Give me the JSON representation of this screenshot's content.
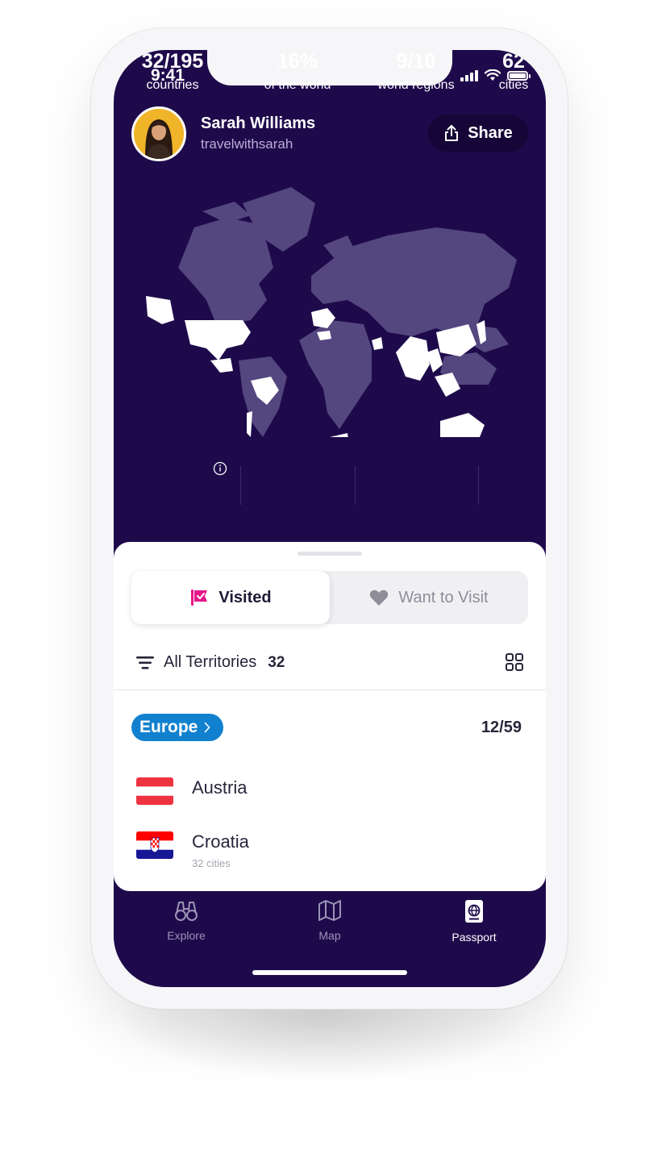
{
  "status": {
    "time": "9:41"
  },
  "profile": {
    "name": "Sarah Williams",
    "handle": "travelwithsarah"
  },
  "share_label": "Share",
  "stats": [
    {
      "value": "32/195",
      "label": "countries"
    },
    {
      "value": "16%",
      "label": "of the world"
    },
    {
      "value": "9/10",
      "label": "world regions"
    },
    {
      "value": "62",
      "label": "cities"
    }
  ],
  "segments": {
    "visited": "Visited",
    "want": "Want to Visit"
  },
  "filter": {
    "label": "All Territories",
    "count": "32"
  },
  "region": {
    "name": "Europe",
    "count": "12/59"
  },
  "countries": [
    {
      "name": "Austria",
      "sub": ""
    },
    {
      "name": "Croatia",
      "sub": "32 cities"
    }
  ],
  "tabs": {
    "explore": "Explore",
    "map": "Map",
    "passport": "Passport"
  },
  "colors": {
    "screen_bg": "#1e0a4b",
    "map_land": "#54467e",
    "map_visited": "#ffffff",
    "region_pill": "#1181cf",
    "visited_icon": "#e5178a"
  }
}
